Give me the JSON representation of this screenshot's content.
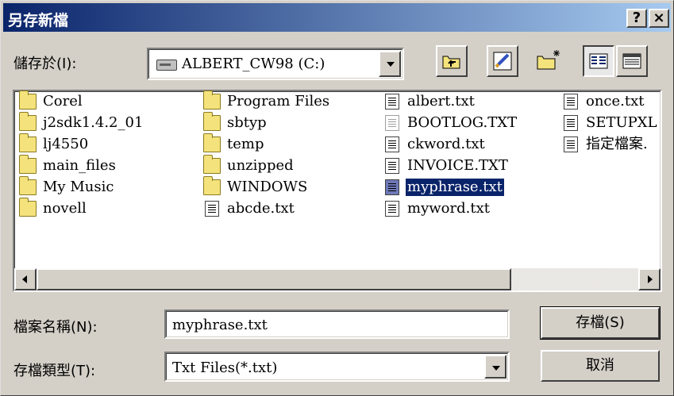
{
  "window": {
    "title": "另存新檔",
    "help_label": "?",
    "close_label": "×"
  },
  "save_in": {
    "label": "儲存於(I):",
    "drive_label": "ALBERT_CW98 (C:)"
  },
  "toolbar": {
    "icons": [
      "up-one-level-icon",
      "desktop-icon",
      "new-folder-icon",
      "list-view-icon",
      "details-view-icon"
    ]
  },
  "files": {
    "columns": [
      [
        {
          "name": "Corel",
          "type": "folder"
        },
        {
          "name": "j2sdk1.4.2_01",
          "type": "folder"
        },
        {
          "name": "lj4550",
          "type": "folder"
        },
        {
          "name": "main_files",
          "type": "folder"
        },
        {
          "name": "My Music",
          "type": "folder"
        },
        {
          "name": "novell",
          "type": "folder"
        }
      ],
      [
        {
          "name": "Program Files",
          "type": "folder"
        },
        {
          "name": "sbtyp",
          "type": "folder"
        },
        {
          "name": "temp",
          "type": "folder"
        },
        {
          "name": "unzipped",
          "type": "folder"
        },
        {
          "name": "WINDOWS",
          "type": "folder"
        },
        {
          "name": "abcde.txt",
          "type": "txt"
        }
      ],
      [
        {
          "name": "albert.txt",
          "type": "txt"
        },
        {
          "name": "BOOTLOG.TXT",
          "type": "txt-gray"
        },
        {
          "name": "ckword.txt",
          "type": "txt"
        },
        {
          "name": "INVOICE.TXT",
          "type": "txt"
        },
        {
          "name": "myphrase.txt",
          "type": "txt",
          "selected": true
        },
        {
          "name": "myword.txt",
          "type": "txt"
        }
      ],
      [
        {
          "name": "once.txt",
          "type": "txt"
        },
        {
          "name": "SETUPXL",
          "type": "txt"
        },
        {
          "name": "指定檔案.",
          "type": "txt"
        }
      ]
    ]
  },
  "filename": {
    "label": "檔案名稱(N):",
    "value": "myphrase.txt"
  },
  "filetype": {
    "label": "存檔類型(T):",
    "value": "Txt Files(*.txt)"
  },
  "buttons": {
    "save": "存檔(S)",
    "cancel": "取消"
  },
  "colors": {
    "title_gradient_start": "#0a246a",
    "title_gradient_end": "#a6caf0",
    "selection": "#0a246a",
    "face": "#d4d0c8"
  }
}
